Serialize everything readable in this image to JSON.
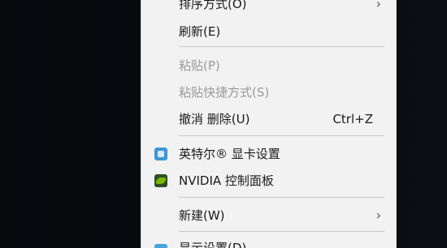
{
  "menu": {
    "items": [
      {
        "label": "排序方式(O)",
        "icon": "",
        "submenu": true
      },
      {
        "label": "刷新(E)"
      },
      {
        "label": "粘贴(P)",
        "disabled": true
      },
      {
        "label": "粘贴快捷方式(S)",
        "disabled": true
      },
      {
        "label": "撤消 删除(U)",
        "shortcut": "Ctrl+Z"
      },
      {
        "label": "英特尔® 显卡设置",
        "icon": "intel-graphics-icon"
      },
      {
        "label": "NVIDIA 控制面板",
        "icon": "nvidia-icon"
      },
      {
        "label": "新建(W)",
        "submenu": true
      },
      {
        "label": "显示设置(D)",
        "icon": "display-settings-icon"
      }
    ],
    "submenu_arrow": "›"
  }
}
